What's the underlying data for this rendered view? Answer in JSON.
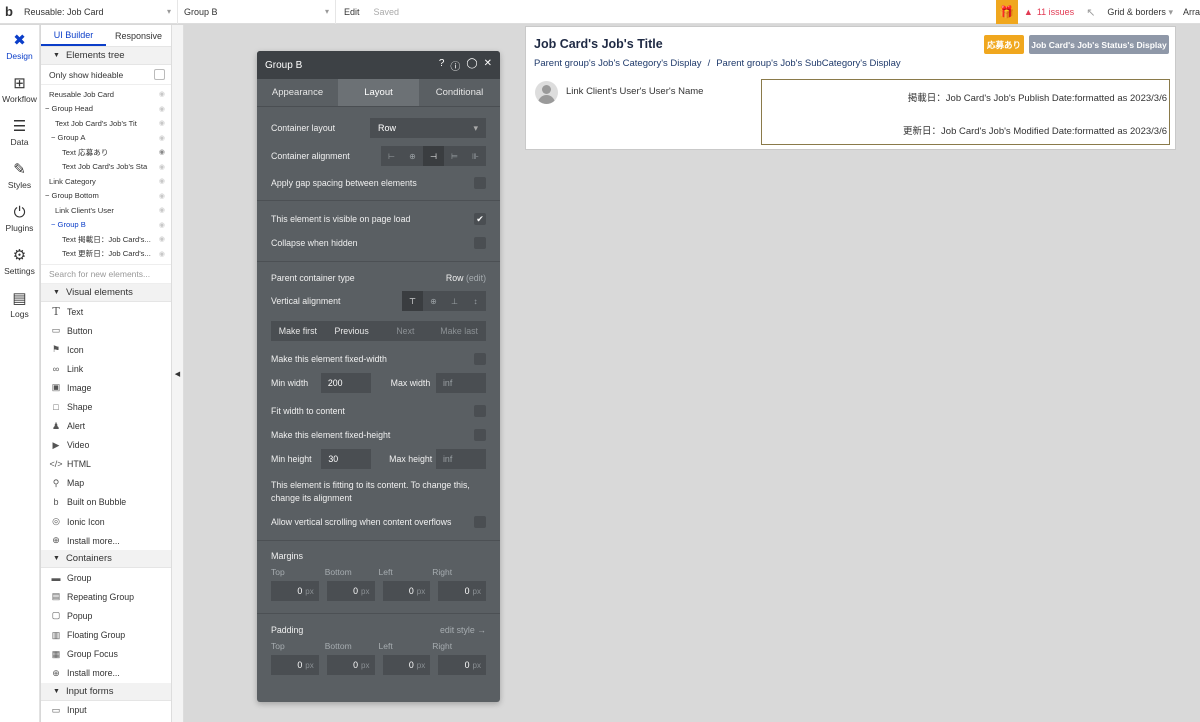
{
  "topbar": {
    "logo": "b",
    "page_select": "Reusable: Job Card",
    "element_select": "Group B",
    "edit_label": "Edit",
    "saved_label": "Saved",
    "issues_label": "11 issues",
    "grid_label": "Grid & borders",
    "arr_label": "Arra"
  },
  "rail": [
    {
      "label": "Design",
      "icon": "design-icon"
    },
    {
      "label": "Workflow",
      "icon": "workflow-icon"
    },
    {
      "label": "Data",
      "icon": "data-icon"
    },
    {
      "label": "Styles",
      "icon": "styles-icon"
    },
    {
      "label": "Plugins",
      "icon": "plugins-icon"
    },
    {
      "label": "Settings",
      "icon": "settings-icon"
    },
    {
      "label": "Logs",
      "icon": "logs-icon"
    }
  ],
  "side": {
    "tab_ui": "UI Builder",
    "tab_responsive": "Responsive",
    "elements_tree_header": "Elements tree",
    "only_show_hideable": "Only show hideable",
    "tree": [
      "Reusable Job Card",
      "Group Head",
      "Text Job Card's Job's Tit",
      "Group A",
      "Text 応募あり",
      "Text Job Card's Job's Sta",
      "Link Category",
      "Group Bottom",
      "Link Client's User",
      "Group B",
      "Text 掲載日：Job Card's...",
      "Text 更新日：Job Card's..."
    ],
    "search_placeholder": "Search for new elements...",
    "visual_header": "Visual elements",
    "visual_items": [
      "Text",
      "Button",
      "Icon",
      "Link",
      "Image",
      "Shape",
      "Alert",
      "Video",
      "HTML",
      "Map",
      "Built on Bubble",
      "Ionic Icon",
      "Install more..."
    ],
    "containers_header": "Containers",
    "container_items": [
      "Group",
      "Repeating Group",
      "Popup",
      "Floating Group",
      "Group Focus",
      "Install more..."
    ],
    "input_header": "Input forms",
    "input_items": [
      "Input"
    ]
  },
  "editor": {
    "title": "Group B",
    "tabs": [
      "Appearance",
      "Layout",
      "Conditional"
    ],
    "container_layout_label": "Container layout",
    "container_layout_value": "Row",
    "container_alignment_label": "Container alignment",
    "gap_label": "Apply gap spacing between elements",
    "visible_label": "This element is visible on page load",
    "collapse_label": "Collapse when hidden",
    "parent_type_label": "Parent container type",
    "parent_type_value": "Row",
    "parent_type_edit": "(edit)",
    "vertical_alignment_label": "Vertical alignment",
    "order_buttons": [
      "Make first",
      "Previous",
      "Next",
      "Make last"
    ],
    "fixed_width_label": "Make this element fixed-width",
    "min_width_label": "Min width",
    "min_width_value": "200",
    "max_width_label": "Max width",
    "max_width_placeholder": "inf",
    "fit_width_label": "Fit width to content",
    "fixed_height_label": "Make this element fixed-height",
    "min_height_label": "Min height",
    "min_height_value": "30",
    "max_height_label": "Max height",
    "max_height_placeholder": "inf",
    "fitting_note": "This element is fitting to its content. To change this, change its alignment",
    "scroll_label": "Allow vertical scrolling when content overflows",
    "margins_label": "Margins",
    "side_labels": [
      "Top",
      "Bottom",
      "Left",
      "Right"
    ],
    "margin_values": [
      "0",
      "0",
      "0",
      "0"
    ],
    "padding_label": "Padding",
    "edit_style": "edit style →",
    "padding_values": [
      "0",
      "0",
      "0",
      "0"
    ],
    "unit": "px"
  },
  "card": {
    "title": "Job Card's Job's Title",
    "badge_applied": "応募あり",
    "badge_status": "Job Card's Job's Status's Display",
    "category": "Parent group's Job's Category's Display",
    "separator": "/",
    "subcategory": "Parent group's Job's SubCategory's Display",
    "user_link": "Link Client's User's User's Name",
    "publish_date": "掲載日：Job Card's Job's Publish Date:formatted as 2023/3/6",
    "modified_date": "更新日：Job Card's Job's Modified Date:formatted as 2023/3/6"
  },
  "colors": {
    "accent_blue": "#0b3ec9",
    "badge_orange": "#f0a71e",
    "badge_gray": "#8f98a8",
    "issues_red": "#e23b54"
  }
}
